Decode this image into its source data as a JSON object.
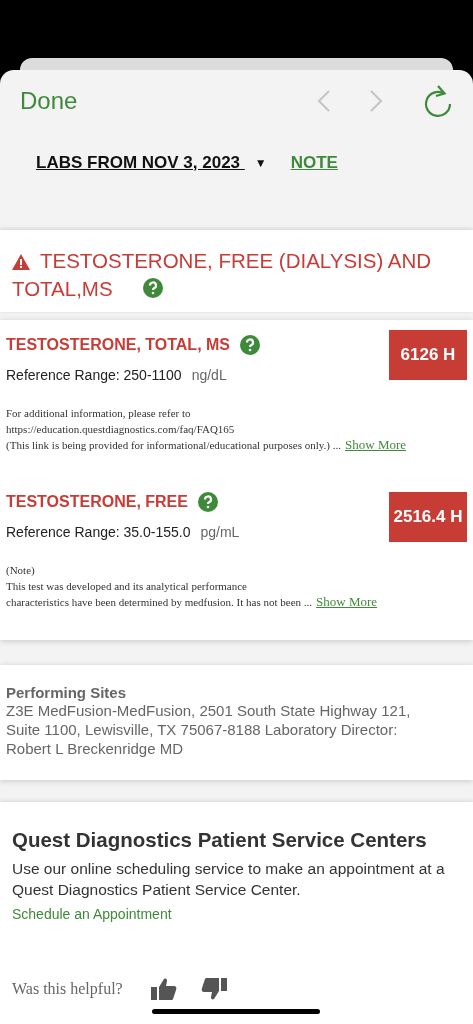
{
  "header": {
    "done": "Done",
    "back": {
      "disabled": true
    },
    "forward": {
      "disabled": true
    }
  },
  "labs": {
    "title": "LABS FROM NOV 3, 2023",
    "dropdown": "▼",
    "note": "NOTE"
  },
  "panel": {
    "title_lines": [
      "TESTOSTERONE, FREE (DIALYSIS) AND",
      "TOTAL,MS"
    ],
    "alert": true
  },
  "results": [
    {
      "name": "TESTOSTERONE, TOTAL, MS",
      "value": "6126 H",
      "abnormal": true,
      "range": "Reference Range: 250-1100",
      "unit": "ng/dL",
      "note_lines": [
        "For additional information, please refer to",
        "https://education.questdiagnostics.com/faq/FAQ165",
        "(This link is being provided for informational/educational purposes only.)"
      ],
      "ellipsis": "...",
      "more": "Show More"
    },
    {
      "name": "TESTOSTERONE, FREE",
      "value": "2516.4 H",
      "abnormal": true,
      "range": "Reference Range: 35.0-155.0",
      "unit": "pg/mL",
      "note_lines": [
        "(Note)",
        "This test was developed and its analytical performance",
        "characteristics have been determined by medfusion. It has not been"
      ],
      "ellipsis": "...",
      "more": "Show More"
    }
  ],
  "sites": {
    "title": "Performing Sites",
    "text": "Z3E MedFusion-MedFusion, 2501 South State Highway 121, Suite 1100, Lewisville, TX 75067-8188 Laboratory Director: Robert L Breckenridge MD"
  },
  "psc": {
    "title": "Quest Diagnostics Patient Service Centers",
    "text": "Use our online scheduling service to make an appointment at a Quest Diagnostics Patient Service Center.",
    "link": "Schedule an Appointment"
  },
  "feedback": {
    "question": "Was this helpful?"
  }
}
